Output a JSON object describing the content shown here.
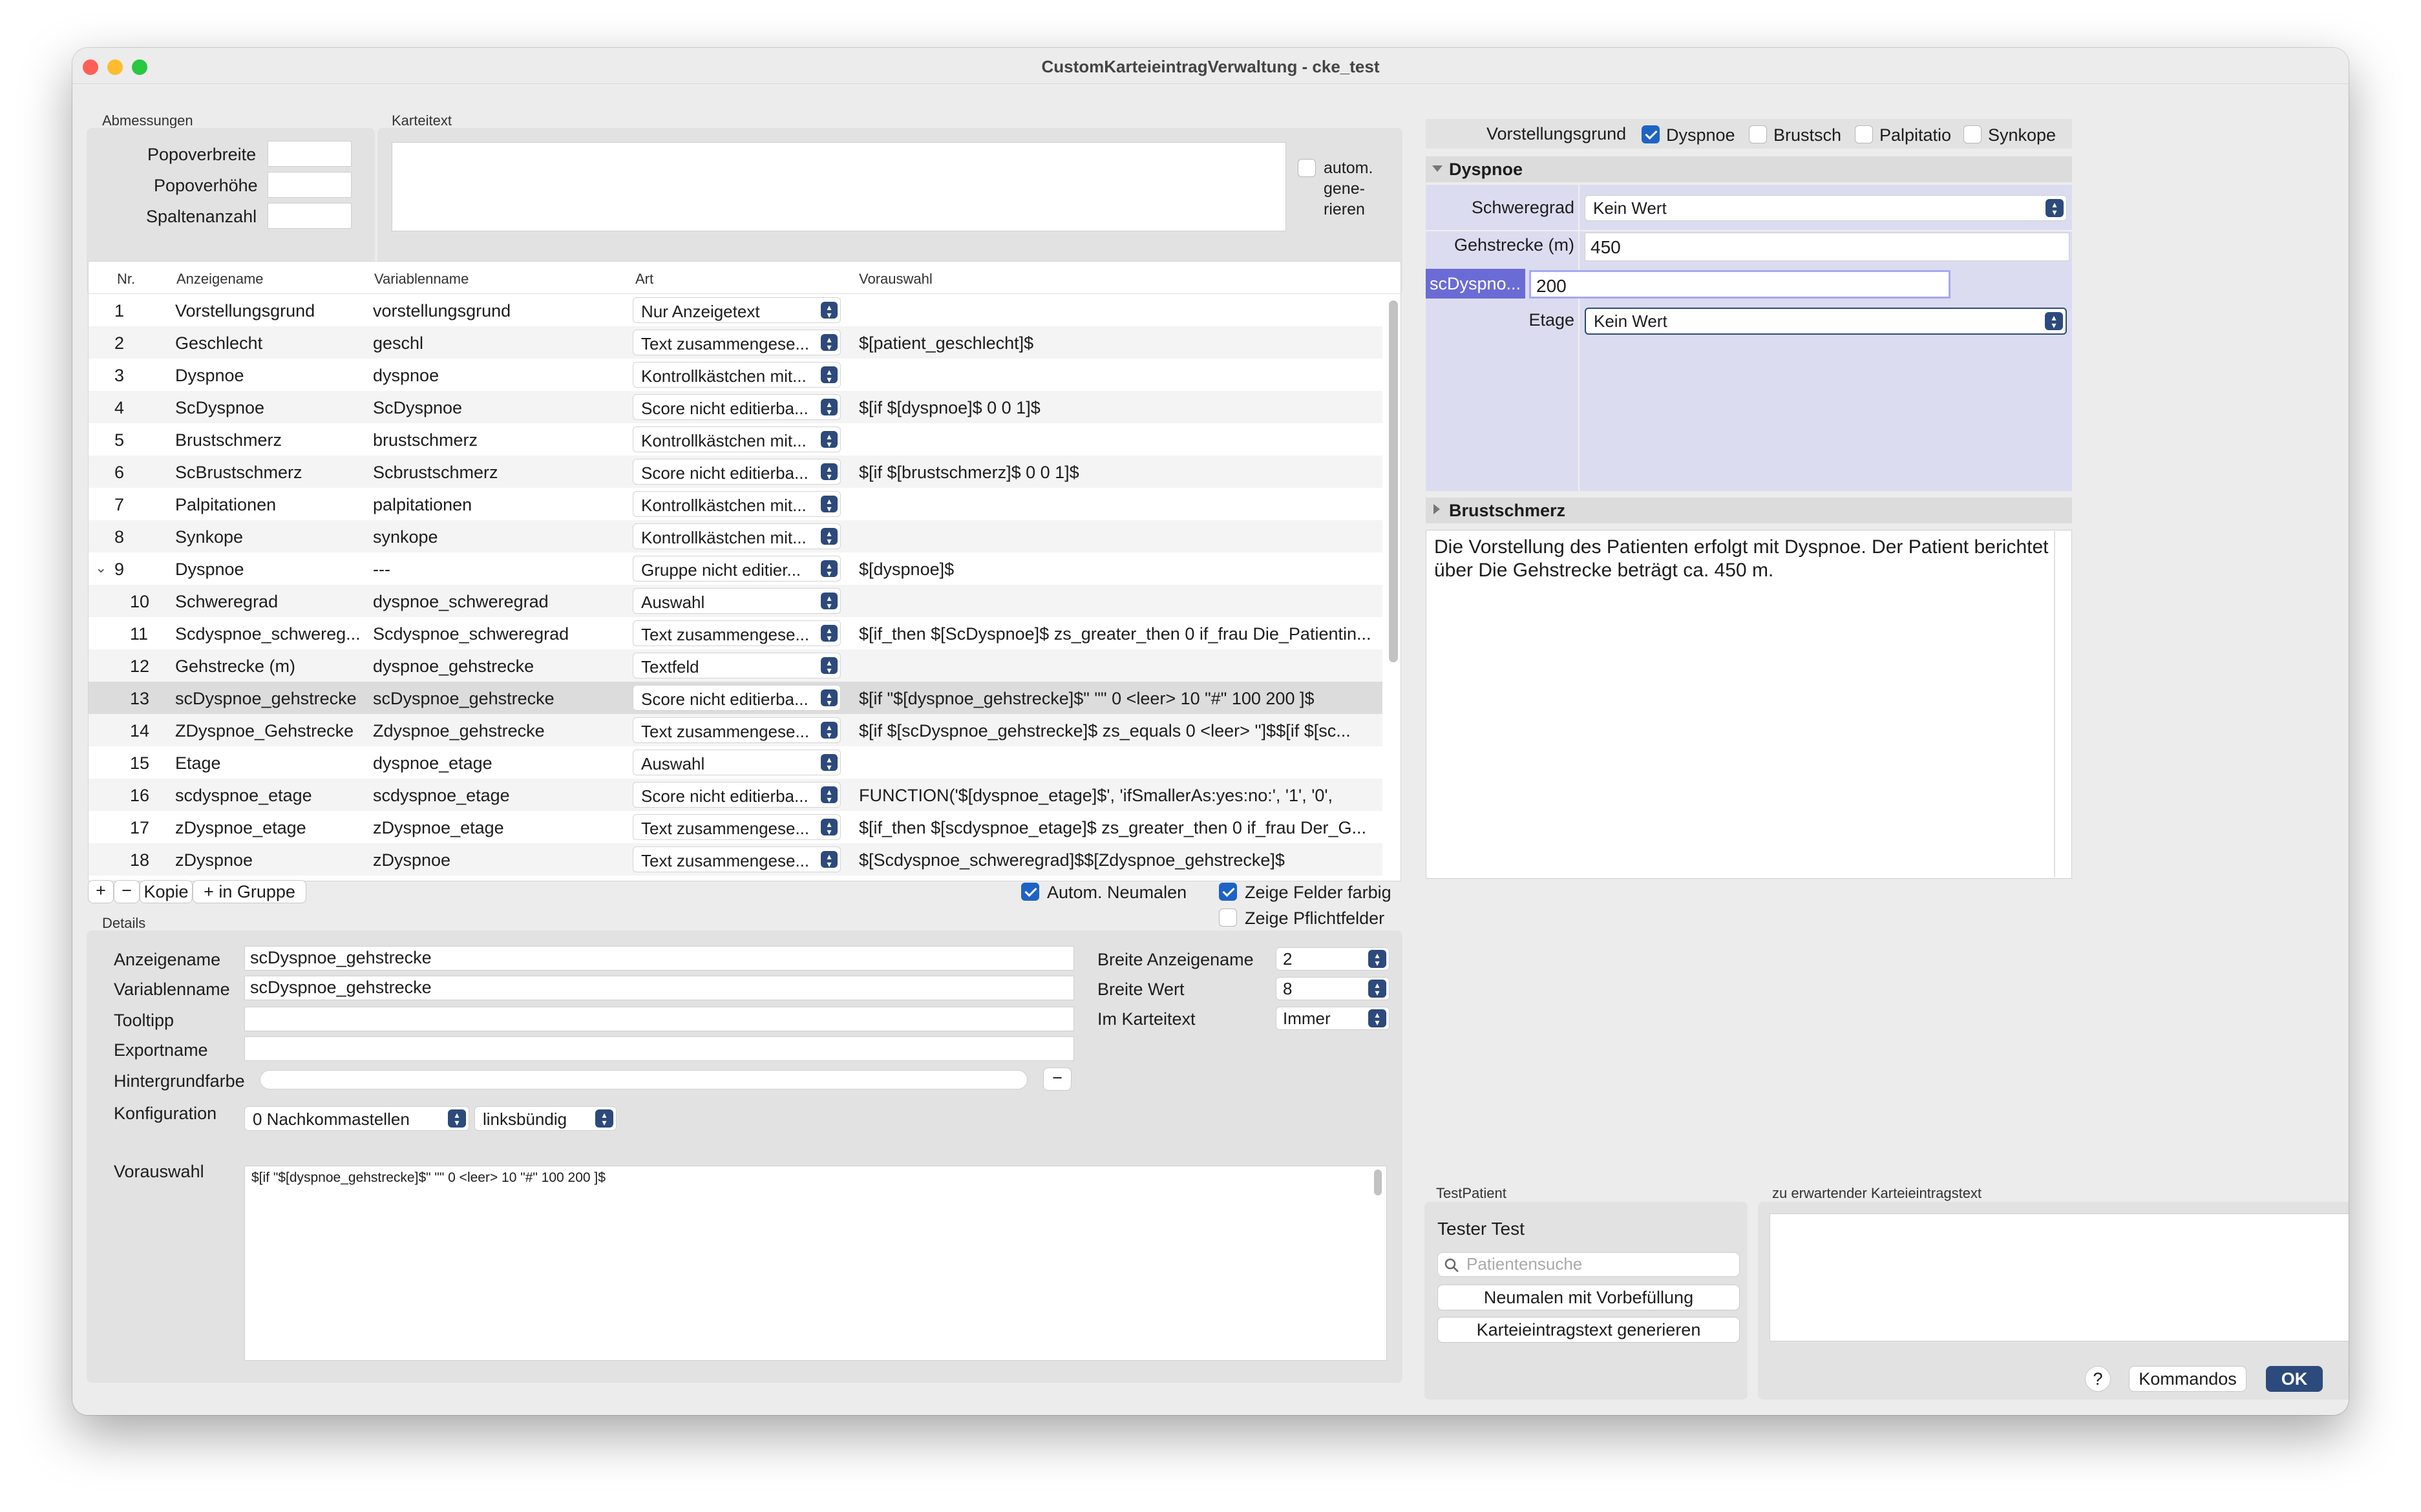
{
  "window": {
    "title": "CustomKarteieintragVerwaltung - cke_test"
  },
  "abmessungen": {
    "header": "Abmessungen",
    "popoverbreite_label": "Popoverbreite",
    "popoverbreite_value": "",
    "popoverhoehe_label": "Popoverhöhe",
    "popoverhoehe_value": "",
    "spaltenanzahl_label": "Spaltenanzahl",
    "spaltenanzahl_value": ""
  },
  "karteitext": {
    "header": "Karteitext",
    "value": "",
    "autogen_label_1": "autom.",
    "autogen_label_2": "gene-",
    "autogen_label_3": "rieren"
  },
  "table": {
    "headers": [
      "Nr.",
      "Anzeigename",
      "Variablenname",
      "Art",
      "Vorauswahl"
    ],
    "rows": [
      {
        "nr": "1",
        "anzeige": "Vorstellungsgrund",
        "var": "vorstellungsgrund",
        "art": "Nur Anzeigetext",
        "vor": ""
      },
      {
        "nr": "2",
        "anzeige": "Geschlecht",
        "var": "geschl",
        "art": "Text zusammengese...",
        "vor": "$[patient_geschlecht]$"
      },
      {
        "nr": "3",
        "anzeige": "Dyspnoe",
        "var": "dyspnoe",
        "art": "Kontrollkästchen mit...",
        "vor": ""
      },
      {
        "nr": "4",
        "anzeige": "ScDyspnoe",
        "var": "ScDyspnoe",
        "art": "Score nicht editierba...",
        "vor": "$[if $[dyspnoe]$ 0 0 1]$"
      },
      {
        "nr": "5",
        "anzeige": "Brustschmerz",
        "var": "brustschmerz",
        "art": "Kontrollkästchen mit...",
        "vor": ""
      },
      {
        "nr": "6",
        "anzeige": "ScBrustschmerz",
        "var": "Scbrustschmerz",
        "art": "Score nicht editierba...",
        "vor": "$[if $[brustschmerz]$ 0 0 1]$"
      },
      {
        "nr": "7",
        "anzeige": "Palpitationen",
        "var": "palpitationen",
        "art": "Kontrollkästchen mit...",
        "vor": ""
      },
      {
        "nr": "8",
        "anzeige": "Synkope",
        "var": "synkope",
        "art": "Kontrollkästchen mit...",
        "vor": ""
      },
      {
        "nr": "9",
        "anzeige": "Dyspnoe",
        "var": "---",
        "art": "Gruppe nicht editier...",
        "vor": "$[dyspnoe]$"
      },
      {
        "nr": "10",
        "anzeige": "Schweregrad",
        "var": "dyspnoe_schweregrad",
        "art": "Auswahl",
        "vor": ""
      },
      {
        "nr": "11",
        "anzeige": "Scdyspnoe_schwereg...",
        "var": "Scdyspnoe_schweregrad",
        "art": "Text zusammengese...",
        "vor": "$[if_then $[ScDyspnoe]$ zs_greater_then 0 if_frau Die_Patientin..."
      },
      {
        "nr": "12",
        "anzeige": "Gehstrecke (m)",
        "var": "dyspnoe_gehstrecke",
        "art": "Textfeld",
        "vor": ""
      },
      {
        "nr": "13",
        "anzeige": "scDyspnoe_gehstrecke",
        "var": "scDyspnoe_gehstrecke",
        "art": "Score nicht editierba...",
        "vor": "$[if \"$[dyspnoe_gehstrecke]$\"  \"\" 0 <leer> 10 \"#\" 100 200 ]$"
      },
      {
        "nr": "14",
        "anzeige": "ZDyspnoe_Gehstrecke",
        "var": "Zdyspnoe_gehstrecke",
        "art": "Text zusammengese...",
        "vor": "$[if $[scDyspnoe_gehstrecke]$ zs_equals 0 <leer> '']$$[if $[sc..."
      },
      {
        "nr": "15",
        "anzeige": "Etage",
        "var": "dyspnoe_etage",
        "art": "Auswahl",
        "vor": ""
      },
      {
        "nr": "16",
        "anzeige": "scdyspnoe_etage",
        "var": "scdyspnoe_etage",
        "art": "Score nicht editierba...",
        "vor": "FUNCTION('$[dyspnoe_etage]$', 'ifSmallerAs:yes:no:', '1', '0',"
      },
      {
        "nr": "17",
        "anzeige": "zDyspnoe_etage",
        "var": "zDyspnoe_etage",
        "art": "Text zusammengese...",
        "vor": "$[if_then $[scdyspnoe_etage]$ zs_greater_then 0 if_frau Der_G..."
      },
      {
        "nr": "18",
        "anzeige": "zDyspnoe",
        "var": "zDyspnoe",
        "art": "Text zusammengese...",
        "vor": "$[Scdyspnoe_schweregrad]$$[Zdyspnoe_gehstrecke]$"
      }
    ]
  },
  "table_toolbar": {
    "add": "+",
    "remove": "−",
    "copy": "Kopie",
    "in_group": "+ in Gruppe",
    "autom_neumalen": "Autom. Neumalen",
    "zeige_felder_farbig": "Zeige Felder farbig",
    "zeige_pflichtfelder": "Zeige Pflichtfelder"
  },
  "details": {
    "header": "Details",
    "anzeigename_label": "Anzeigename",
    "anzeigename_value": "scDyspnoe_gehstrecke",
    "variablenname_label": "Variablenname",
    "variablenname_value": "scDyspnoe_gehstrecke",
    "tooltipp_label": "Tooltipp",
    "tooltipp_value": "",
    "exportname_label": "Exportname",
    "exportname_value": "",
    "hintergrundfarbe_label": "Hintergrundfarbe",
    "konfiguration_label": "Konfiguration",
    "nachkommastellen": "0 Nachkommastellen",
    "ausrichtung": "linksbündig",
    "breite_anzeigename_label": "Breite Anzeigename",
    "breite_anzeigename_value": "2",
    "breite_wert_label": "Breite Wert",
    "breite_wert_value": "8",
    "im_karteitext_label": "Im Karteitext",
    "im_karteitext_value": "Immer",
    "vorauswahl_label": "Vorauswahl",
    "vorauswahl_value": "$[if \"$[dyspnoe_gehstrecke]$\"  \"\" 0 <leer> 10 \"#\" 100 200 ]$",
    "minus": "−"
  },
  "preview": {
    "vorstellungsgrund_label": "Vorstellungsgrund",
    "cb_dyspnoe": "Dyspnoe",
    "cb_brustsch": "Brustsch",
    "cb_palpitatio": "Palpitatio",
    "cb_synkope": "Synkope",
    "section_dyspnoe": "Dyspnoe",
    "schweregrad_label": "Schweregrad",
    "schweregrad_value": "Kein Wert",
    "gehstrecke_label": "Gehstrecke (m)",
    "gehstrecke_value": "450",
    "scdyspnoe_label": "scDyspno...",
    "scdyspnoe_value": "200",
    "etage_label": "Etage",
    "etage_value": "Kein Wert",
    "section_brustschmerz": "Brustschmerz",
    "karteitext_output": "Die Vorstellung des Patienten erfolgt mit Dyspnoe. Der Patient berichtet über  Die Gehstrecke beträgt ca. 450 m."
  },
  "testpatient": {
    "header": "TestPatient",
    "name": "Tester Test",
    "search_placeholder": "Patientensuche",
    "neumalen_btn": "Neumalen mit Vorbefüllung",
    "generieren_btn": "Karteieintragstext generieren",
    "expected_header": "zu erwartender Karteieintragstext",
    "expected_value": ""
  },
  "footer": {
    "help": "?",
    "kommandos": "Kommandos",
    "ok": "OK"
  },
  "colors": {
    "accent": "#2c4a7b",
    "checkbox": "#1e63c4",
    "highlight_bg": "#dcdcf0",
    "label_highlight": "#6b6bd6"
  },
  "icons": {
    "close": "close-icon",
    "minimize": "minimize-icon",
    "zoom": "zoom-icon",
    "search": "search-icon",
    "chevron": "chevron-updown-icon"
  }
}
